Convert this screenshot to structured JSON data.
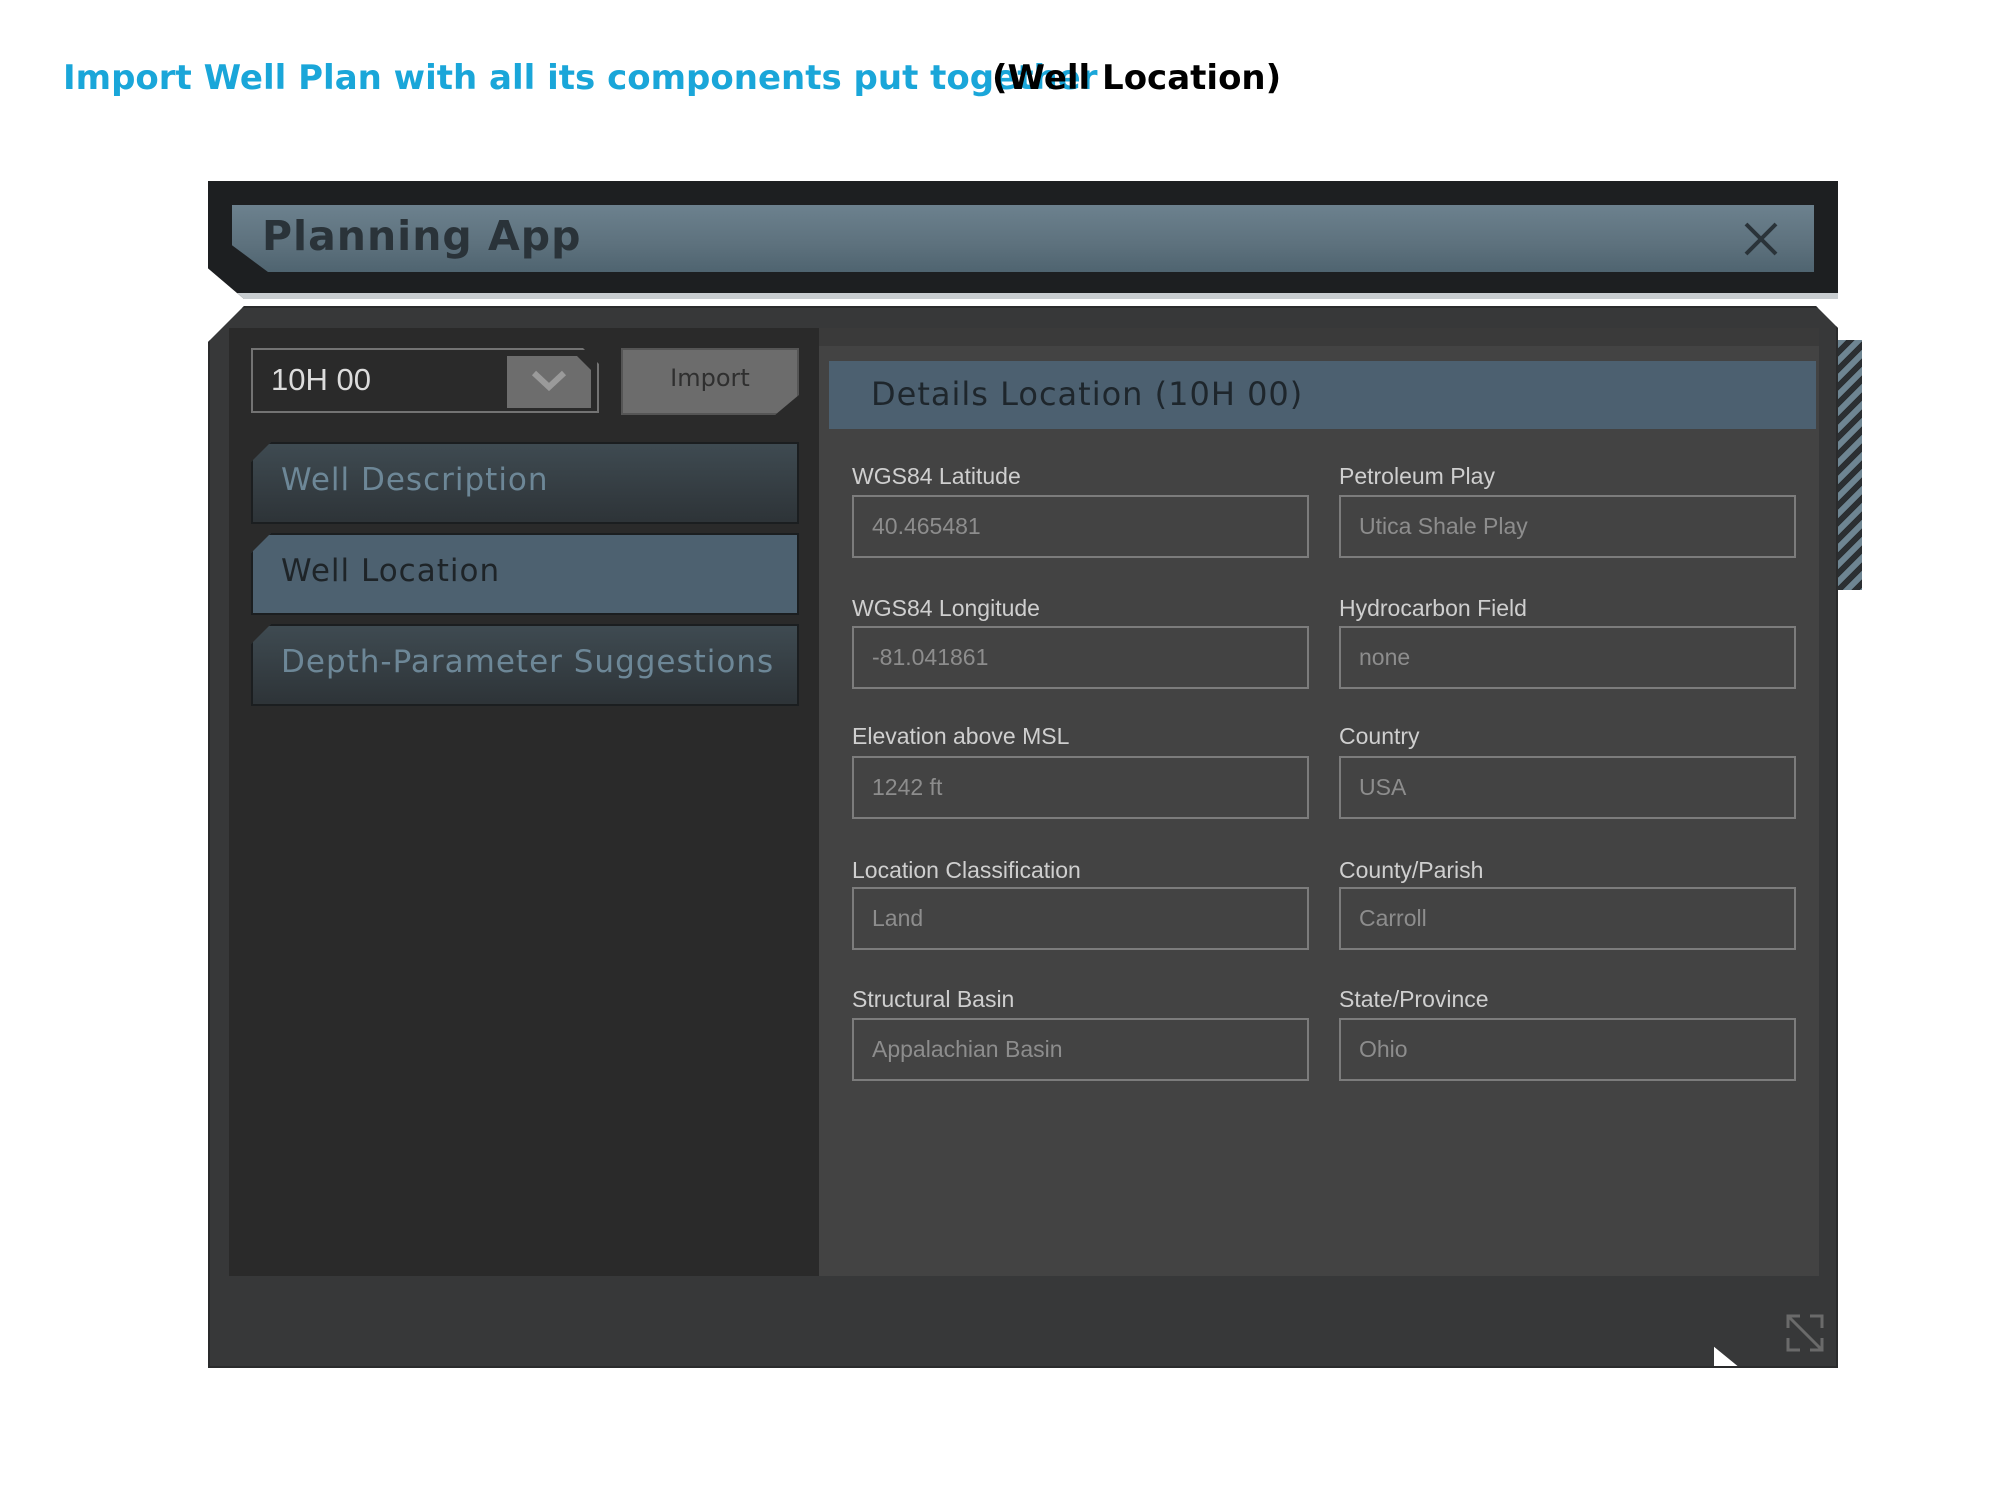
{
  "captions": {
    "main": "Import Well Plan with all its components put together",
    "sub": "(Well Location)"
  },
  "app": {
    "title": "Planning App",
    "close_icon": "close-icon",
    "resize_icon": "resize-icon"
  },
  "well_select": {
    "value": "10H 00",
    "icon": "chevron-down-icon"
  },
  "import_button": {
    "label": "Import"
  },
  "nav": [
    {
      "label": "Well Description",
      "active": false
    },
    {
      "label": "Well Location",
      "active": true
    },
    {
      "label": "Depth-Parameter Suggestions",
      "active": false
    }
  ],
  "details": {
    "title": "Details Location (10H 00)",
    "fields": [
      {
        "label": "WGS84 Latitude",
        "value": "40.465481"
      },
      {
        "label": "Petroleum Play",
        "value": "Utica Shale Play"
      },
      {
        "label": "WGS84 Longitude",
        "value": "-81.041861"
      },
      {
        "label": "Hydrocarbon Field",
        "value": "none"
      },
      {
        "label": "Elevation above MSL",
        "value": "1242 ft"
      },
      {
        "label": "Country",
        "value": "USA"
      },
      {
        "label": "Location Classification",
        "value": "Land"
      },
      {
        "label": "County/Parish",
        "value": "Carroll"
      },
      {
        "label": "Structural Basin",
        "value": "Appalachian Basin"
      },
      {
        "label": "State/Province",
        "value": "Ohio"
      }
    ]
  },
  "colors": {
    "caption_accent": "#1aa6d9",
    "titlebar": "#5d717d",
    "active_nav": "#4d6170",
    "panel_dark": "#2a2a2a",
    "panel_mid": "#434343"
  }
}
